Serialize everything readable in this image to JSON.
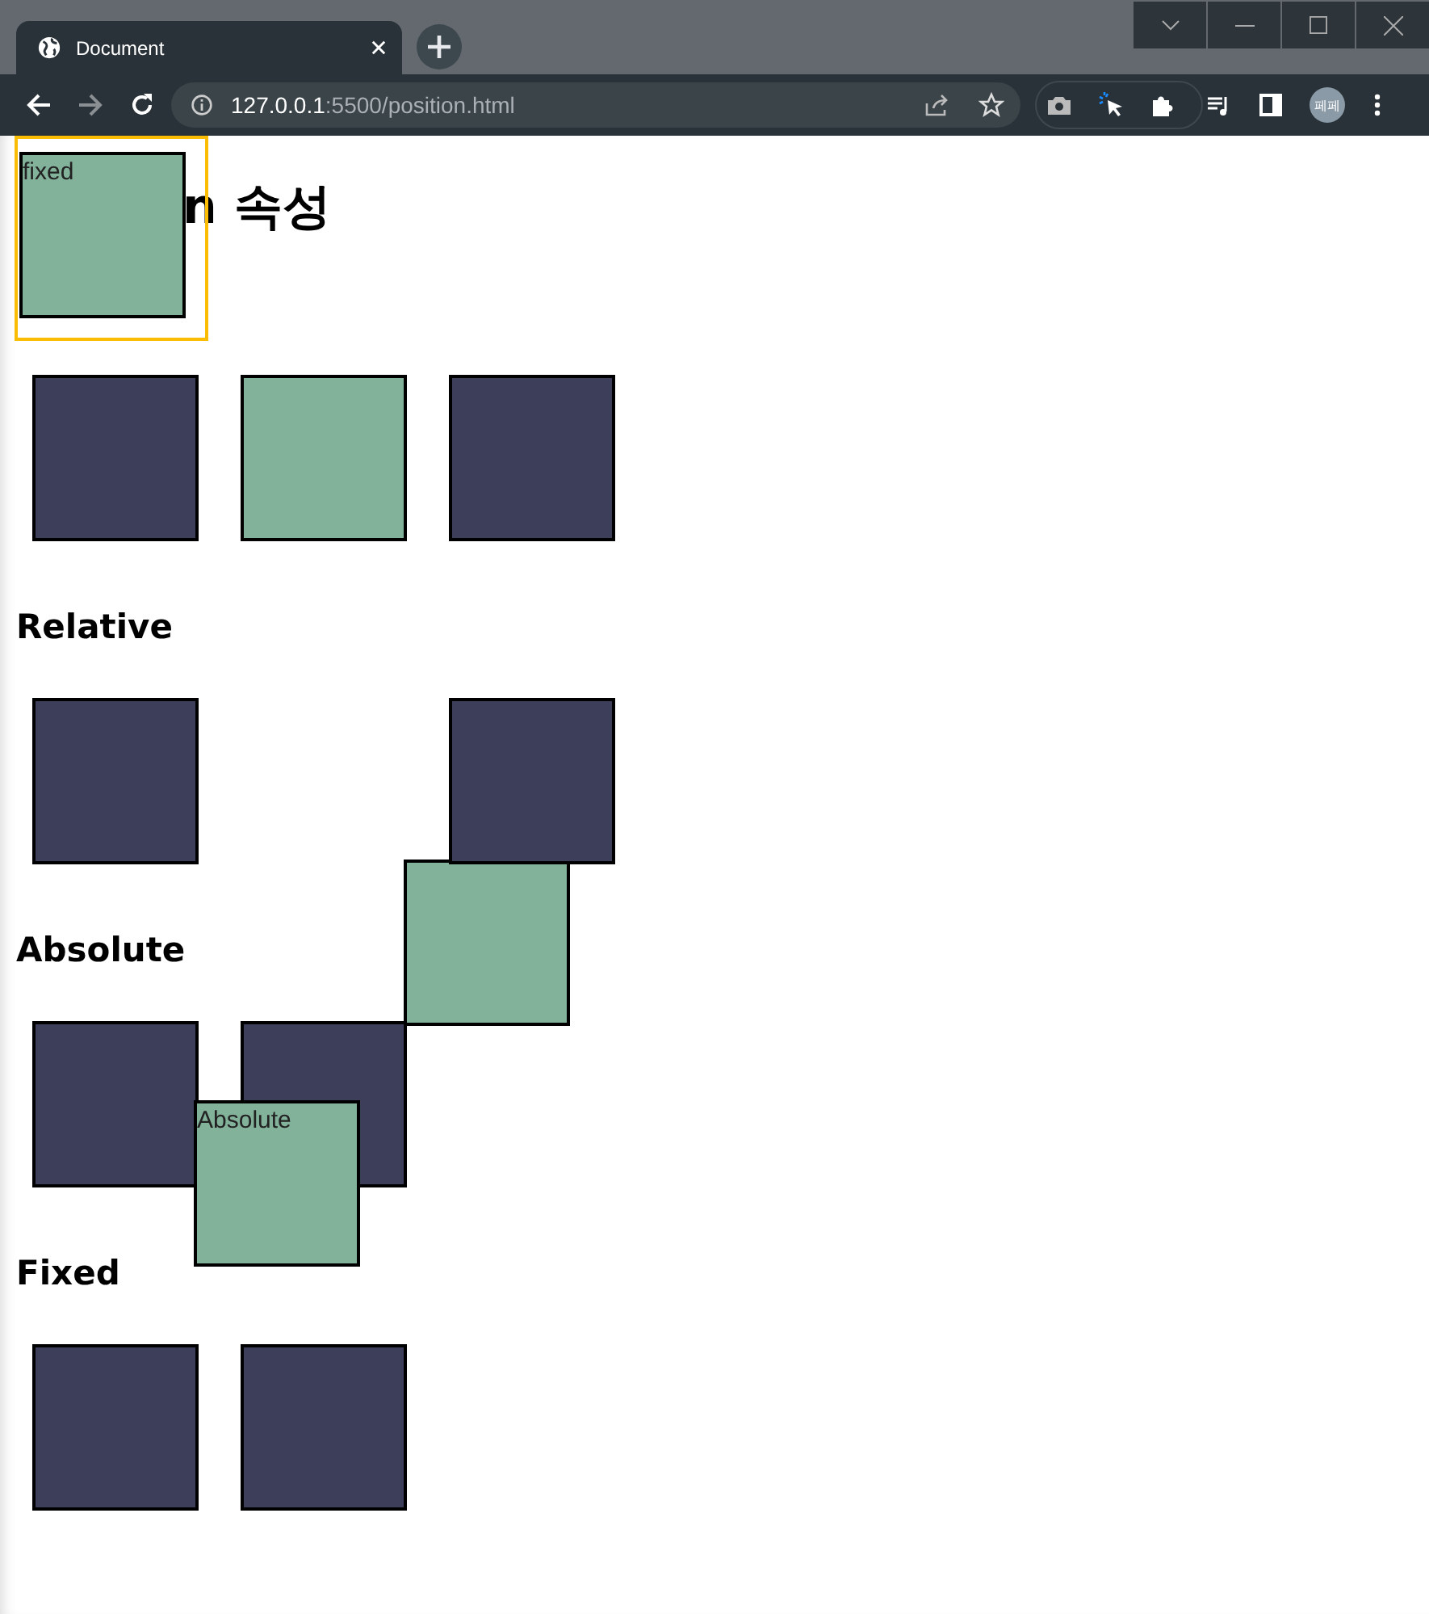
{
  "browser": {
    "tab_title": "Document",
    "url_host": "127.0.0.1",
    "url_rest": ":5500/position.html",
    "profile": "페페"
  },
  "page": {
    "heading": "n 속성",
    "fixed_box": {
      "label": "fixed",
      "highlighted": true
    },
    "sections": [
      {
        "boxes": [
          {
            "kind": "dark"
          },
          {
            "kind": "green"
          },
          {
            "kind": "dark"
          }
        ]
      },
      {
        "title": "Relative",
        "boxes": [
          {
            "kind": "dark"
          },
          {
            "kind": "green_shifted"
          },
          {
            "kind": "dark"
          }
        ]
      },
      {
        "title": "Absolute",
        "boxes": [
          {
            "kind": "dark"
          },
          {
            "kind": "dark"
          },
          {
            "kind": "green_overlay",
            "label": "Absolute"
          }
        ]
      },
      {
        "title": "Fixed",
        "boxes": [
          {
            "kind": "dark"
          },
          {
            "kind": "dark"
          }
        ]
      }
    ]
  }
}
